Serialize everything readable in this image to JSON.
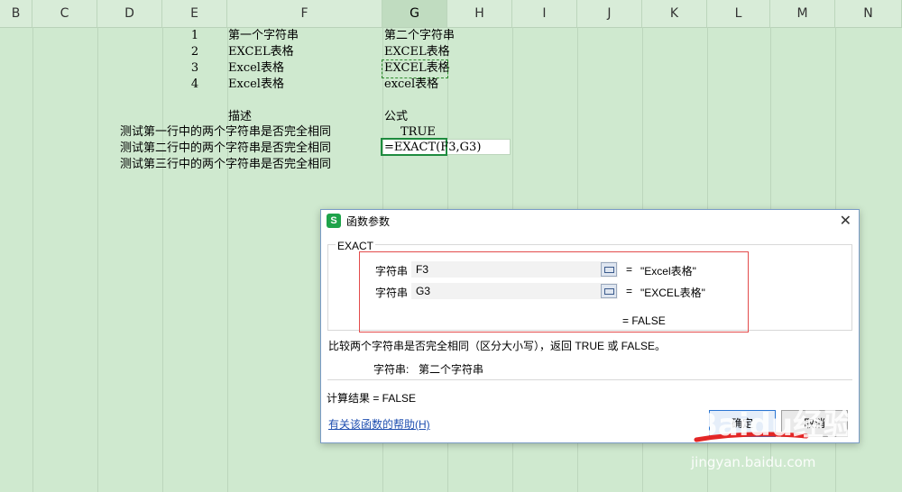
{
  "columns": [
    "B",
    "C",
    "D",
    "E",
    "F",
    "G",
    "H",
    "I",
    "J",
    "K",
    "L",
    "M",
    "N"
  ],
  "active_column": "G",
  "rows": [
    {
      "e": "1",
      "f": "第一个字符串",
      "g": "第二个字符串"
    },
    {
      "e": "2",
      "f": "EXCEL表格",
      "g": "EXCEL表格"
    },
    {
      "e": "3",
      "f": "Excel表格",
      "g": "EXCEL表格"
    },
    {
      "e": "4",
      "f": "Excel表格",
      "g": "excel表格"
    }
  ],
  "section": {
    "desc_header": "描述",
    "formula_header": "公式"
  },
  "tests": [
    {
      "desc": "测试第一行中的两个字符串是否完全相同",
      "result": "TRUE"
    },
    {
      "desc": "测试第二行中的两个字符串是否完全相同",
      "formula": "=EXACT(F3,G3)"
    },
    {
      "desc": "测试第三行中的两个字符串是否完全相同"
    }
  ],
  "dialog": {
    "title": "函数参数",
    "close_icon": "close-icon",
    "function_name": "EXACT",
    "args": [
      {
        "label": "字符串",
        "value": "F3",
        "result": "\"Excel表格\""
      },
      {
        "label": "字符串",
        "value": "G3",
        "result": "\"EXCEL表格\""
      }
    ],
    "eq": "=",
    "overall_result": "= FALSE",
    "description": "比较两个字符串是否完全相同（区分大小写），返回 TRUE 或 FALSE。",
    "arg_help_label": "字符串:",
    "arg_help_text": "第二个字符串",
    "calc_result": "计算结果 = FALSE",
    "help_link": "有关该函数的帮助(H)",
    "ok_label": "确定",
    "cancel_label": "取消",
    "accent": "#1ea34a"
  },
  "watermark": {
    "logo": "Baidu经验",
    "url": "jingyan.baidu.com"
  }
}
